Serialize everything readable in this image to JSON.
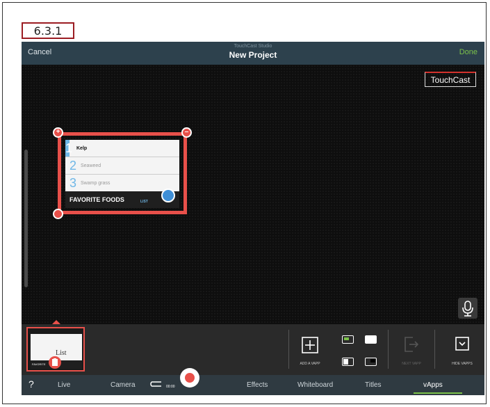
{
  "step_label": "6.3.1",
  "navbar": {
    "cancel_label": "Cancel",
    "app_name": "TouchCast Studio",
    "title": "New Project",
    "done_label": "Done"
  },
  "stage": {
    "logo_text": "TouchCast"
  },
  "vapp": {
    "items": [
      {
        "num": "1",
        "text": "Kelp"
      },
      {
        "num": "2",
        "text": "Seaweed"
      },
      {
        "num": "3",
        "text": "Swamp grass"
      }
    ],
    "footer_title": "FAVORITE FOODS",
    "footer_type": "LIST"
  },
  "tray": {
    "thumb_label": "List",
    "thumb_footer": "FAVORITE",
    "add_vapp_label": "ADD A VAPP",
    "next_vapp_label": "NEXT VAPP",
    "hide_vapps_label": "HIDE VAPPS"
  },
  "tabbar": {
    "help_label": "?",
    "tabs": [
      "Live",
      "Camera",
      "Effects",
      "Whiteboard",
      "Titles",
      "vApps"
    ],
    "timer": "00:00",
    "active_tab": "vApps"
  },
  "colors": {
    "accent": "#e8504a",
    "done": "#7cc24a",
    "navbar": "#2d414d",
    "list_blue": "#6fb7e6"
  }
}
